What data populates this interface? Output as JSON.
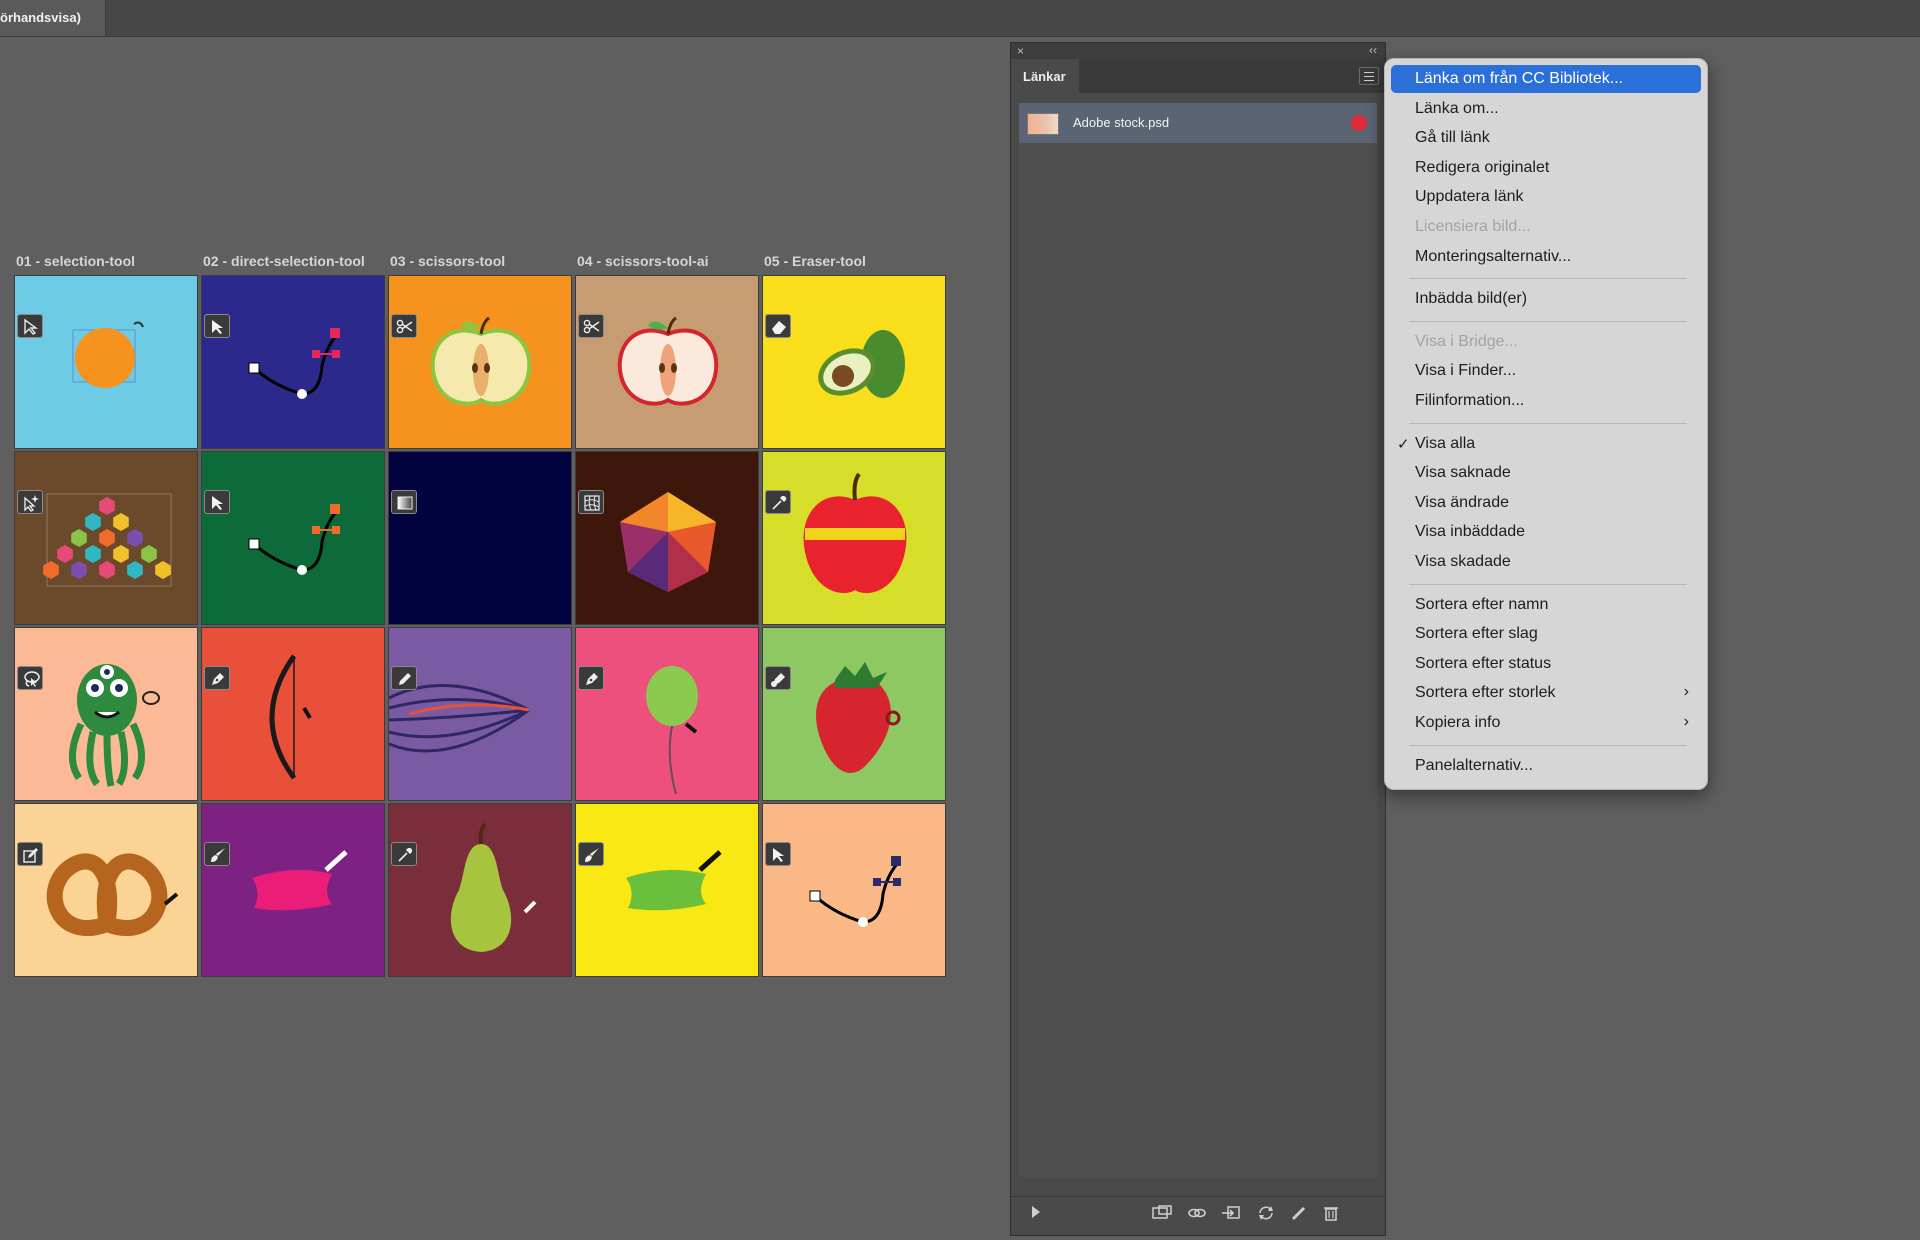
{
  "document_tab": {
    "title": "örhandsvisa)"
  },
  "columns": [
    {
      "label": "01 - selection-tool"
    },
    {
      "label": "02 - direct-selection-tool"
    },
    {
      "label": "03 - scissors-tool"
    },
    {
      "label": "04 - scissors-tool-ai"
    },
    {
      "label": "05 - Eraser-tool"
    }
  ],
  "tiles": [
    {
      "bg": "#6dcbe6",
      "badge": "arrow-outline-icon",
      "art": "orange-circle"
    },
    {
      "bg": "#2b2a8c",
      "badge": "arrow-solid-icon",
      "art": "path-pink"
    },
    {
      "bg": "#f6921e",
      "badge": "scissors-icon",
      "art": "apple-half-yellow"
    },
    {
      "bg": "#c69c72",
      "badge": "scissors-icon",
      "art": "apple-half-red"
    },
    {
      "bg": "#f9de1c",
      "badge": "eraser-icon",
      "art": "avocado"
    },
    {
      "bg": "#6b4a2b",
      "badge": "magic-selection-icon",
      "art": "hexagons"
    },
    {
      "bg": "#0c6b38",
      "badge": "arrow-solid-icon",
      "art": "path-orange"
    },
    {
      "bg": "#03043f",
      "badge": "gradient-icon",
      "art": "none"
    },
    {
      "bg": "#3d170b",
      "badge": "mesh-icon",
      "art": "gem"
    },
    {
      "bg": "#d6de2a",
      "badge": "eyedropper-icon",
      "art": "red-apple"
    },
    {
      "bg": "#fbb996",
      "badge": "lasso-icon",
      "art": "octopus"
    },
    {
      "bg": "#e8503a",
      "badge": "pen-icon",
      "art": "bow"
    },
    {
      "bg": "#7a5ba3",
      "badge": "pencil-icon",
      "art": "strands"
    },
    {
      "bg": "#ee507e",
      "badge": "pen-icon",
      "art": "balloon"
    },
    {
      "bg": "#8dc863",
      "badge": "blob-icon",
      "art": "strawberry"
    },
    {
      "bg": "#fbd495",
      "badge": "edit-box-icon",
      "art": "pretzel"
    },
    {
      "bg": "#7d2282",
      "badge": "brush-icon",
      "art": "brush-pink"
    },
    {
      "bg": "#7a2e3b",
      "badge": "eyedropper-icon",
      "art": "pear"
    },
    {
      "bg": "#f9e813",
      "badge": "brush-icon",
      "art": "brush-green"
    },
    {
      "bg": "#f9b886",
      "badge": "arrow-solid-icon",
      "art": "path-navy"
    }
  ],
  "panel": {
    "tab_label": "Länkar",
    "close_glyph": "×",
    "collapse_glyph": "‹‹",
    "links": [
      {
        "name": "Adobe stock.psd"
      }
    ]
  },
  "menu": {
    "items": [
      {
        "label": "Länka om från CC Bibliotek...",
        "state": "active"
      },
      {
        "label": "Länka om...",
        "state": "normal"
      },
      {
        "label": "Gå till länk",
        "state": "normal"
      },
      {
        "label": "Redigera originalet",
        "state": "normal"
      },
      {
        "label": "Uppdatera länk",
        "state": "normal"
      },
      {
        "label": "Licensiera bild...",
        "state": "disabled"
      },
      {
        "label": "Monteringsalternativ...",
        "state": "normal"
      },
      {
        "sep": true
      },
      {
        "label": "Inbädda bild(er)",
        "state": "normal"
      },
      {
        "sep": true
      },
      {
        "label": "Visa i Bridge...",
        "state": "disabled"
      },
      {
        "label": "Visa i Finder...",
        "state": "normal"
      },
      {
        "label": "Filinformation...",
        "state": "normal"
      },
      {
        "sep": true
      },
      {
        "label": "Visa alla",
        "state": "checked"
      },
      {
        "label": "Visa saknade",
        "state": "normal"
      },
      {
        "label": "Visa ändrade",
        "state": "normal"
      },
      {
        "label": "Visa inbäddade",
        "state": "normal"
      },
      {
        "label": "Visa skadade",
        "state": "normal"
      },
      {
        "sep": true
      },
      {
        "label": "Sortera efter namn",
        "state": "normal"
      },
      {
        "label": "Sortera efter slag",
        "state": "normal"
      },
      {
        "label": "Sortera efter status",
        "state": "normal"
      },
      {
        "label": "Sortera efter storlek",
        "state": "normal",
        "submenu": true
      },
      {
        "label": "Kopiera info",
        "state": "normal",
        "submenu": true
      },
      {
        "sep": true
      },
      {
        "label": "Panelalternativ...",
        "state": "normal"
      }
    ],
    "check_glyph": "✓",
    "submenu_glyph": "›"
  }
}
